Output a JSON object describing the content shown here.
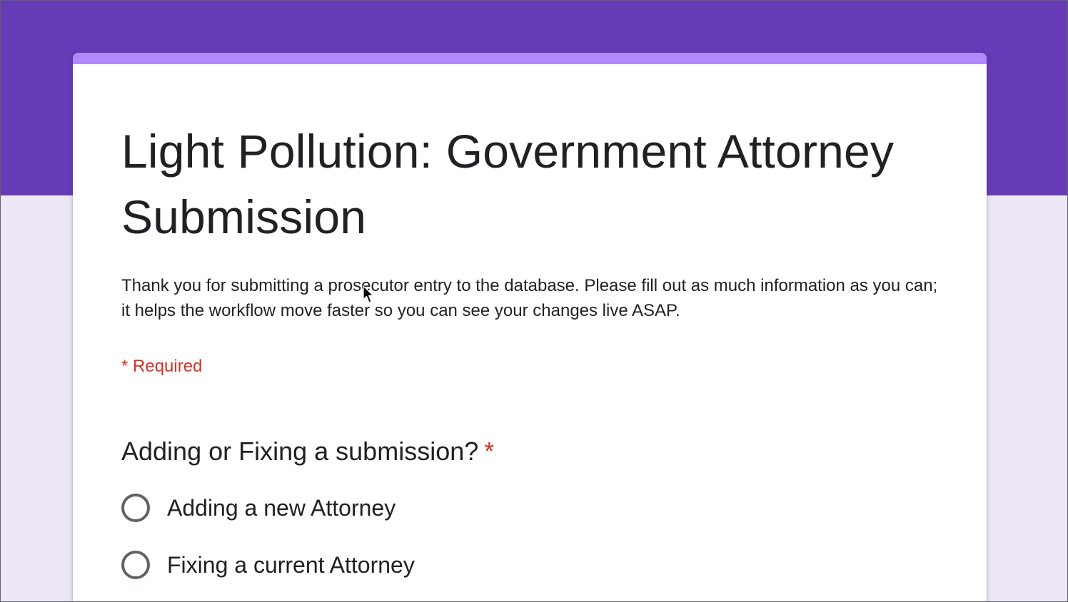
{
  "colors": {
    "header_band": "#673ab7",
    "page_background": "#ede7f6",
    "card_accent": "#b388ff",
    "required": "#d93025",
    "text": "#202124"
  },
  "form": {
    "title": "Light Pollution: Government Attorney Submission",
    "description": "Thank you for submitting a prosecutor entry to the database. Please fill out as much information as you can; it helps the workflow move faster so you can see your changes live ASAP.",
    "required_note": "* Required"
  },
  "question": {
    "title": "Adding or Fixing a submission?",
    "required_marker": "*",
    "options": [
      {
        "label": "Adding a new Attorney",
        "selected": false
      },
      {
        "label": "Fixing a current Attorney",
        "selected": false
      }
    ]
  },
  "icons": {
    "cursor": "mouse-pointer-icon",
    "radio": "radio-unchecked-icon"
  }
}
